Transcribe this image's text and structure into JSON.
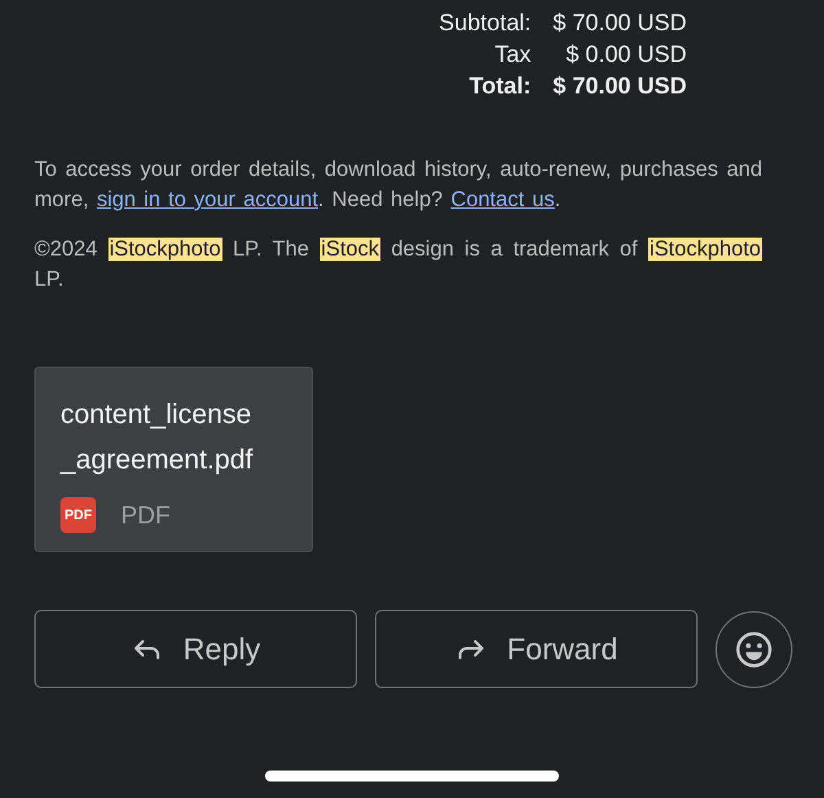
{
  "totals": [
    {
      "label": "Subtotal:",
      "value": "$ 70.00 USD",
      "kind": "normal"
    },
    {
      "label": "Tax",
      "value": "$ 0.00 USD",
      "kind": "normal"
    },
    {
      "label": "Total:",
      "value": "$ 70.00 USD",
      "kind": "total"
    }
  ],
  "access_note": [
    {
      "text": "To access your order details, download history, auto-renew, purchases and more, ",
      "kind": "text"
    },
    {
      "text": "sign in to your account",
      "kind": "link"
    },
    {
      "text": ". Need help? ",
      "kind": "text"
    },
    {
      "text": "Contact us",
      "kind": "link"
    },
    {
      "text": ".",
      "kind": "text"
    }
  ],
  "copyright": [
    {
      "text": "©2024 ",
      "highlight": false
    },
    {
      "text": "iStockphoto",
      "highlight": true
    },
    {
      "text": " LP. The ",
      "highlight": false
    },
    {
      "text": "iStock",
      "highlight": true
    },
    {
      "text": " design is a trademark of ",
      "highlight": false
    },
    {
      "text": "iStockphoto",
      "highlight": true
    },
    {
      "text": " LP.",
      "highlight": false
    }
  ],
  "attachment": {
    "name_lines": [
      "content_license",
      "_agreement.pdf"
    ],
    "icon_text": "PDF",
    "type": "PDF"
  },
  "actions": [
    {
      "label": "Reply",
      "kind": "reply"
    },
    {
      "label": "Forward",
      "kind": "forward"
    }
  ]
}
